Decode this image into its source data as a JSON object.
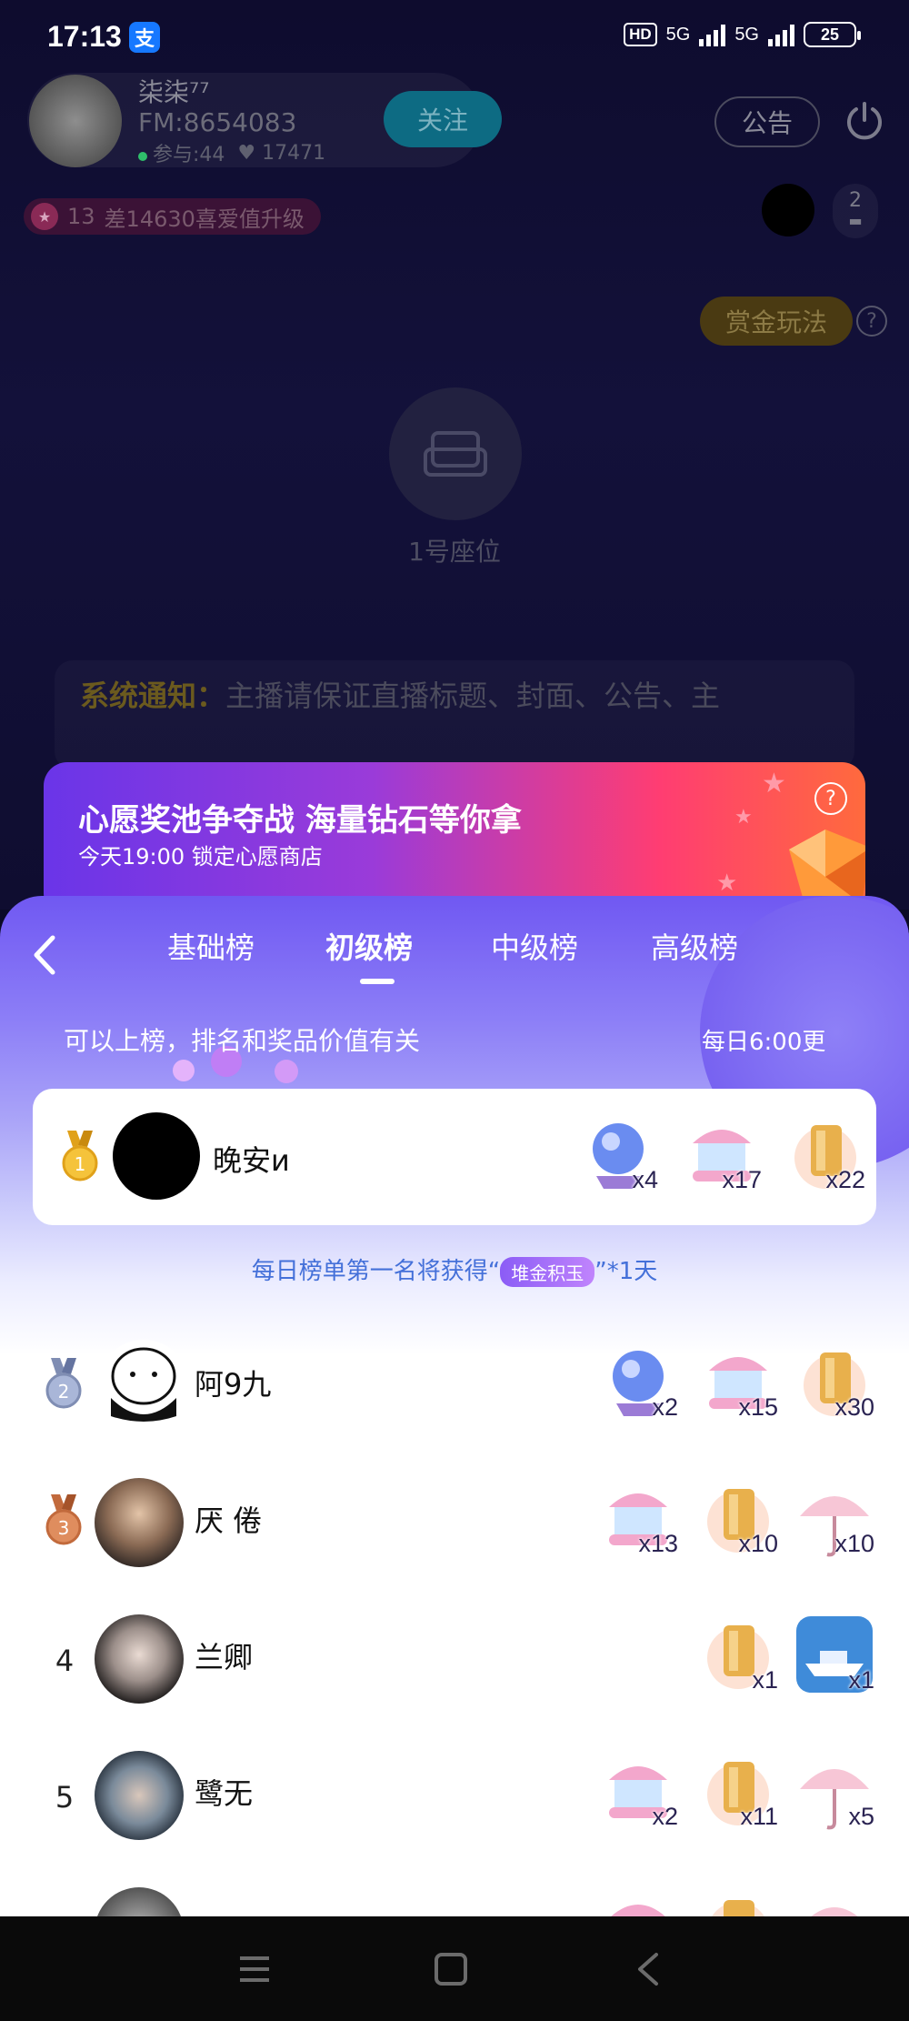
{
  "status_bar": {
    "time": "17:13",
    "alipay": "支",
    "hd": "HD",
    "network1": "5G",
    "network2": "5G",
    "battery": "25"
  },
  "host": {
    "name": "柒柒⁷⁷",
    "fm": "FM:8654083",
    "participants": "参与:44",
    "likes": "17471",
    "follow_label": "关注"
  },
  "top_right": {
    "notice_label": "公告",
    "viewer_count": "2"
  },
  "level": {
    "level_num": "13",
    "text": "差14630喜爱值升级"
  },
  "bounty": {
    "label": "赏金玩法",
    "help": "?"
  },
  "seat": {
    "label": "1号座位"
  },
  "system_notice": {
    "prefix": "系统通知：",
    "text": "主播请保证直播标题、封面、公告、主"
  },
  "wish_banner": {
    "title": "心愿奖池争夺战 海量钻石等你拿",
    "subtitle": "今天19:00 锁定心愿商店",
    "help": "?"
  },
  "ranking": {
    "tabs": [
      {
        "label": "基础榜",
        "active": false
      },
      {
        "label": "初级榜",
        "active": true
      },
      {
        "label": "中级榜",
        "active": false
      },
      {
        "label": "高级榜",
        "active": false
      }
    ],
    "rule_text": "可以上榜，排名和奖品价值有关",
    "update_time": "每日6:00更",
    "reward_prefix": "每日榜单第一名将获得“",
    "reward_tag": "堆金积玉",
    "reward_suffix": "”*1天",
    "entries": [
      {
        "rank": "1",
        "name": "晚安и",
        "gifts": [
          {
            "kind": "crystal-ball",
            "count": "x4"
          },
          {
            "kind": "carousel",
            "count": "x17"
          },
          {
            "kind": "gold-bars",
            "count": "x22"
          }
        ]
      },
      {
        "rank": "2",
        "name": "阿9九",
        "gifts": [
          {
            "kind": "crystal-ball",
            "count": "x2"
          },
          {
            "kind": "carousel",
            "count": "x15"
          },
          {
            "kind": "gold-bars",
            "count": "x30"
          }
        ]
      },
      {
        "rank": "3",
        "name": "厌 倦",
        "gifts": [
          {
            "kind": "carousel",
            "count": "x13"
          },
          {
            "kind": "gold-bars",
            "count": "x10"
          },
          {
            "kind": "umbrella",
            "count": "x10"
          }
        ]
      },
      {
        "rank": "4",
        "name": "兰卿",
        "gifts": [
          {
            "kind": "gold-bars",
            "count": "x1"
          },
          {
            "kind": "yacht",
            "count": "x1"
          }
        ]
      },
      {
        "rank": "5",
        "name": "鹭无",
        "gifts": [
          {
            "kind": "carousel",
            "count": "x2"
          },
          {
            "kind": "gold-bars",
            "count": "x11"
          },
          {
            "kind": "umbrella",
            "count": "x5"
          }
        ]
      }
    ]
  },
  "colors": {
    "panel_top": "#7058f2",
    "reward_text": "#4470d9",
    "banner_left": "#6a35e8",
    "banner_right": "#ff6a3d"
  }
}
